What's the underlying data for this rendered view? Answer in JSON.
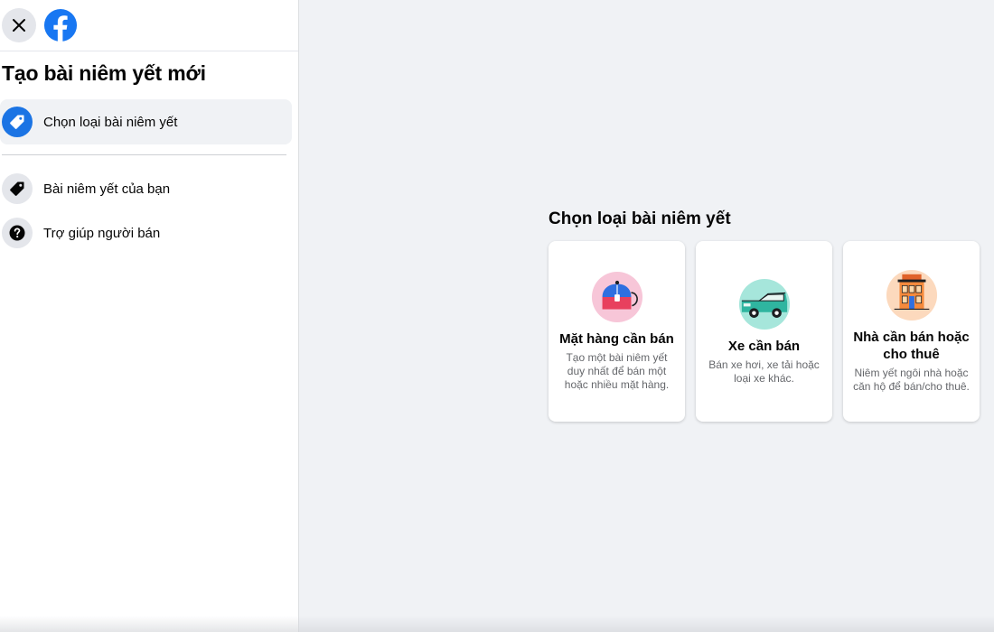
{
  "sidebar": {
    "title": "Tạo bài niêm yết mới",
    "items": [
      {
        "label": "Chọn loại bài niêm yết",
        "icon": "tag-icon",
        "active": true
      },
      {
        "label": "Bài niêm yết của bạn",
        "icon": "tag-icon",
        "active": false
      },
      {
        "label": "Trợ giúp người bán",
        "icon": "question-icon",
        "active": false
      }
    ]
  },
  "main": {
    "title": "Chọn loại bài niêm yết",
    "cards": [
      {
        "title": "Mặt hàng cần bán",
        "description": "Tạo một bài niêm yết duy nhất để bán một hoặc nhiều mặt hàng.",
        "icon": "item-for-sale-icon"
      },
      {
        "title": "Xe cần bán",
        "description": "Bán xe hơi, xe tải hoặc loại xe khác.",
        "icon": "vehicle-for-sale-icon"
      },
      {
        "title": "Nhà cần bán hoặc cho thuê",
        "description": "Niêm yết ngôi nhà hoặc căn hộ để bán/cho thuê.",
        "icon": "home-for-sale-icon"
      }
    ]
  },
  "colors": {
    "brand_blue": "#1877f2",
    "active_icon_bg": "#1b74e4",
    "page_bg": "#f0f2f5"
  }
}
